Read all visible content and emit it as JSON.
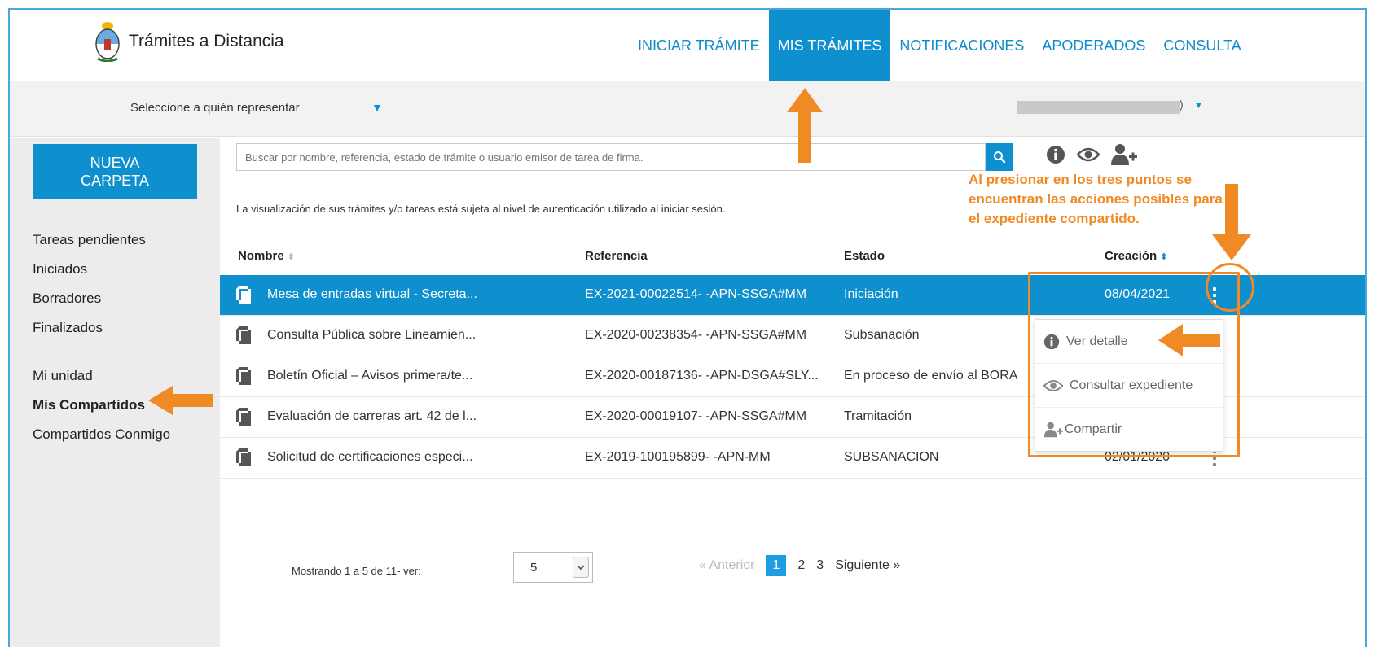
{
  "header": {
    "brand_title": "Trámites a Distancia",
    "nav": [
      {
        "label": "INICIAR TRÁMITE",
        "active": false
      },
      {
        "label": "MIS TRÁMITES",
        "active": true
      },
      {
        "label": "NOTIFICACIONES",
        "active": false
      },
      {
        "label": "APODERADOS",
        "active": false
      },
      {
        "label": "CONSULTA",
        "active": false
      }
    ],
    "accent_color": "#0e8fce"
  },
  "subbar": {
    "represent_label": "Seleccione a quién representar",
    "user_tail": ")"
  },
  "sidebar": {
    "new_folder_label": "NUEVA CARPETA",
    "items_top": [
      {
        "label": "Tareas pendientes"
      },
      {
        "label": "Iniciados"
      },
      {
        "label": "Borradores"
      },
      {
        "label": "Finalizados"
      }
    ],
    "items_bottom": [
      {
        "label": "Mi unidad"
      },
      {
        "label": "Mis Compartidos",
        "selected": true
      },
      {
        "label": "Compartidos Conmigo"
      }
    ]
  },
  "search": {
    "placeholder": "Buscar por nombre, referencia, estado de trámite o usuario emisor de tarea de firma."
  },
  "notice": "La visualización de sus trámites y/o tareas está sujeta al nivel de autenticación utilizado al iniciar sesión.",
  "annotation": "Al presionar en los tres puntos se encuentran las acciones posibles para el expediente compartido.",
  "annotation_color": "#f08a24",
  "table": {
    "headers": {
      "nombre": "Nombre",
      "referencia": "Referencia",
      "estado": "Estado",
      "creacion": "Creación"
    },
    "rows": [
      {
        "nombre": "Mesa de entradas virtual - Secreta...",
        "referencia": "EX-2021-00022514- -APN-SSGA#MM",
        "estado": "Iniciación",
        "creacion": "08/04/2021",
        "selected": true
      },
      {
        "nombre": "Consulta Pública sobre Lineamien...",
        "referencia": "EX-2020-00238354- -APN-SSGA#MM",
        "estado": "Subsanación",
        "creacion": ""
      },
      {
        "nombre": "Boletín Oficial – Avisos primera/te...",
        "referencia": "EX-2020-00187136- -APN-DSGA#SLY...",
        "estado": "En proceso de envío al BORA",
        "creacion": ""
      },
      {
        "nombre": "Evaluación de carreras art. 42 de l...",
        "referencia": "EX-2020-00019107- -APN-SSGA#MM",
        "estado": "Tramitación",
        "creacion": ""
      },
      {
        "nombre": "Solicitud de certificaciones especi...",
        "referencia": "EX-2019-100195899- -APN-MM",
        "estado": "SUBSANACION",
        "creacion": "02/01/2020"
      }
    ]
  },
  "row_menu": {
    "items": [
      {
        "label": "Ver detalle",
        "icon": "info-icon"
      },
      {
        "label": "Consultar expediente",
        "icon": "eye-icon"
      },
      {
        "label": "Compartir",
        "icon": "user-plus-icon"
      }
    ]
  },
  "pagination": {
    "info": "Mostrando 1 a 5 de 11- ver:",
    "page_size": "5",
    "prev": "« Anterior",
    "pages": [
      "1",
      "2",
      "3"
    ],
    "current": "1",
    "next": "Siguiente »"
  }
}
